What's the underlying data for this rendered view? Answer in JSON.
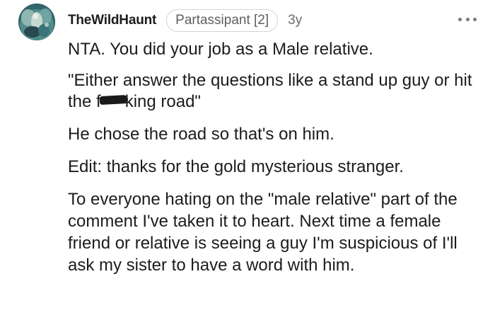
{
  "comment": {
    "username": "TheWildHaunt",
    "flair": "Partassipant [2]",
    "age": "3y",
    "avatar_icon": "avatar-image",
    "more_icon": "more-options-icon",
    "paragraphs": {
      "p1": "NTA. You did your job as a Male relative.",
      "p2_before": "\"Either answer the questions like a stand up guy or hit the f",
      "p2_after": "king road\"",
      "p3": "He chose the road so that's on him.",
      "p4": "Edit: thanks for the gold mysterious stranger.",
      "p5": "To everyone hating on the \"male relative\" part of the comment I've taken it to heart. Next time a female friend or relative is seeing a guy I'm suspicious of I'll ask my sister to have a word with him."
    }
  }
}
